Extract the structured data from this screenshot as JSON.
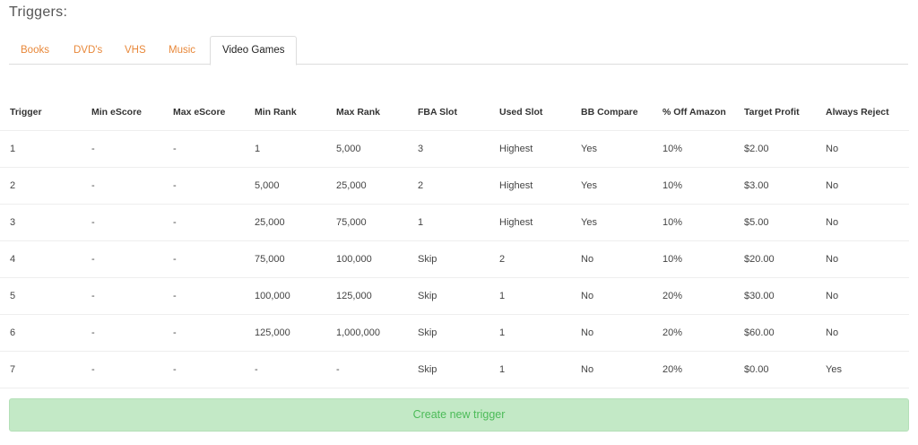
{
  "page_title": "Triggers:",
  "tabs": [
    {
      "label": "Books",
      "active": false
    },
    {
      "label": "DVD's",
      "active": false
    },
    {
      "label": "VHS",
      "active": false
    },
    {
      "label": "Music",
      "active": false
    },
    {
      "label": "Video Games",
      "active": true
    }
  ],
  "table": {
    "columns": [
      "Trigger",
      "Min eScore",
      "Max eScore",
      "Min Rank",
      "Max Rank",
      "FBA Slot",
      "Used Slot",
      "BB Compare",
      "% Off Amazon",
      "Target Profit",
      "Always Reject"
    ],
    "rows": [
      [
        "1",
        "-",
        "-",
        "1",
        "5,000",
        "3",
        "Highest",
        "Yes",
        "10%",
        "$2.00",
        "No"
      ],
      [
        "2",
        "-",
        "-",
        "5,000",
        "25,000",
        "2",
        "Highest",
        "Yes",
        "10%",
        "$3.00",
        "No"
      ],
      [
        "3",
        "-",
        "-",
        "25,000",
        "75,000",
        "1",
        "Highest",
        "Yes",
        "10%",
        "$5.00",
        "No"
      ],
      [
        "4",
        "-",
        "-",
        "75,000",
        "100,000",
        "Skip",
        "2",
        "No",
        "10%",
        "$20.00",
        "No"
      ],
      [
        "5",
        "-",
        "-",
        "100,000",
        "125,000",
        "Skip",
        "1",
        "No",
        "20%",
        "$30.00",
        "No"
      ],
      [
        "6",
        "-",
        "-",
        "125,000",
        "1,000,000",
        "Skip",
        "1",
        "No",
        "20%",
        "$60.00",
        "No"
      ],
      [
        "7",
        "-",
        "-",
        "-",
        "-",
        "Skip",
        "1",
        "No",
        "20%",
        "$0.00",
        "Yes"
      ]
    ]
  },
  "create_button_label": "Create new trigger",
  "colors": {
    "tab_accent": "#e8883a",
    "button_bg": "#c3e9c6",
    "button_text": "#4cbb58"
  }
}
